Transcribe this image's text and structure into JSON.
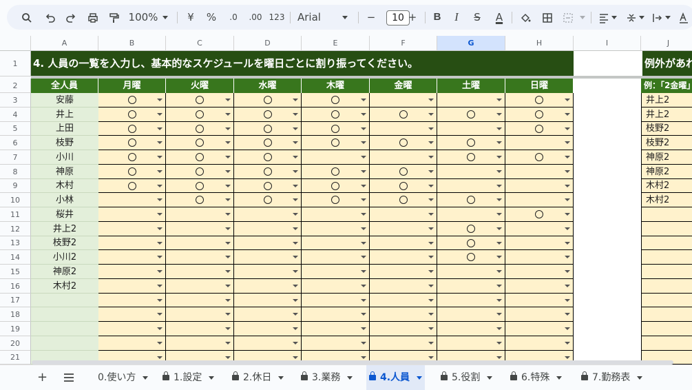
{
  "toolbar": {
    "zoom": "100%",
    "currency": "¥",
    "percent": "%",
    "dec_decrease": ".0",
    "dec_increase": ".00",
    "number_format": "123",
    "font": "Arial",
    "font_size": "10",
    "minus": "−",
    "plus": "+",
    "bold": "B",
    "italic": "I",
    "strike": "S",
    "text_color": "A",
    "text_color_hex": "#000000"
  },
  "columns": [
    "A",
    "B",
    "C",
    "D",
    "E",
    "F",
    "G",
    "H",
    "I",
    "J"
  ],
  "selected_column": "G",
  "title": "4. 人員の一覧を入力し、基本的なスケジュールを曜日ごとに割り振ってください。",
  "title2": "例外があれ",
  "headers": [
    "全人員",
    "月曜",
    "火曜",
    "水曜",
    "木曜",
    "金曜",
    "土曜",
    "日曜"
  ],
  "j_header": "例：「2金曜」",
  "mark": "〇",
  "rows": [
    {
      "num": "3",
      "name": "安藤",
      "days": [
        1,
        1,
        1,
        1,
        0,
        0,
        1
      ],
      "j": "井上2"
    },
    {
      "num": "4",
      "name": "井上",
      "days": [
        1,
        1,
        1,
        1,
        1,
        1,
        1
      ],
      "j": "井上2"
    },
    {
      "num": "5",
      "name": "上田",
      "days": [
        1,
        1,
        1,
        1,
        0,
        0,
        1
      ],
      "j": "枝野2"
    },
    {
      "num": "6",
      "name": "枝野",
      "days": [
        1,
        1,
        1,
        1,
        1,
        1,
        0
      ],
      "j": "枝野2"
    },
    {
      "num": "7",
      "name": "小川",
      "days": [
        1,
        1,
        1,
        0,
        0,
        1,
        1
      ],
      "j": "神原2"
    },
    {
      "num": "8",
      "name": "神原",
      "days": [
        1,
        1,
        1,
        1,
        1,
        0,
        0
      ],
      "j": "神原2"
    },
    {
      "num": "9",
      "name": "木村",
      "days": [
        1,
        1,
        1,
        1,
        1,
        0,
        0
      ],
      "j": "木村2"
    },
    {
      "num": "10",
      "name": "小林",
      "days": [
        0,
        1,
        1,
        1,
        1,
        1,
        0
      ],
      "j": "木村2"
    },
    {
      "num": "11",
      "name": "桜井",
      "days": [
        0,
        0,
        0,
        0,
        0,
        0,
        1
      ],
      "j": ""
    },
    {
      "num": "12",
      "name": "井上2",
      "days": [
        0,
        0,
        0,
        0,
        0,
        1,
        0
      ],
      "j": ""
    },
    {
      "num": "13",
      "name": "枝野2",
      "days": [
        0,
        0,
        0,
        0,
        0,
        1,
        0
      ],
      "j": ""
    },
    {
      "num": "14",
      "name": "小川2",
      "days": [
        0,
        0,
        0,
        0,
        0,
        1,
        0
      ],
      "j": ""
    },
    {
      "num": "15",
      "name": "神原2",
      "days": [
        0,
        0,
        0,
        0,
        0,
        0,
        0
      ],
      "j": ""
    },
    {
      "num": "16",
      "name": "木村2",
      "days": [
        0,
        0,
        0,
        0,
        0,
        0,
        0
      ],
      "j": ""
    },
    {
      "num": "17",
      "name": "",
      "days": [
        0,
        0,
        0,
        0,
        0,
        0,
        0
      ],
      "j": ""
    },
    {
      "num": "18",
      "name": "",
      "days": [
        0,
        0,
        0,
        0,
        0,
        0,
        0
      ],
      "j": ""
    },
    {
      "num": "19",
      "name": "",
      "days": [
        0,
        0,
        0,
        0,
        0,
        0,
        0
      ],
      "j": ""
    },
    {
      "num": "20",
      "name": "",
      "days": [
        0,
        0,
        0,
        0,
        0,
        0,
        0
      ],
      "j": ""
    },
    {
      "num": "21",
      "name": "",
      "days": [
        0,
        0,
        0,
        0,
        0,
        0,
        0
      ],
      "j": ""
    }
  ],
  "row_header_1": "1",
  "row_header_2": "2",
  "sheet_tabs": [
    {
      "label": "0.使い方",
      "locked": false,
      "active": false
    },
    {
      "label": "1.設定",
      "locked": true,
      "active": false
    },
    {
      "label": "2.休日",
      "locked": true,
      "active": false
    },
    {
      "label": "3.業務",
      "locked": true,
      "active": false
    },
    {
      "label": "4.人員",
      "locked": true,
      "active": true
    },
    {
      "label": "5.役割",
      "locked": true,
      "active": false
    },
    {
      "label": "6.特殊",
      "locked": true,
      "active": false
    },
    {
      "label": "7.勤務表",
      "locked": true,
      "active": false
    }
  ],
  "colors": {
    "title_bg": "#274e13",
    "header_bg": "#38761d",
    "name_bg": "#e3efda",
    "day_bg": "#fff2cc",
    "active_tab": "#0b57d0"
  }
}
